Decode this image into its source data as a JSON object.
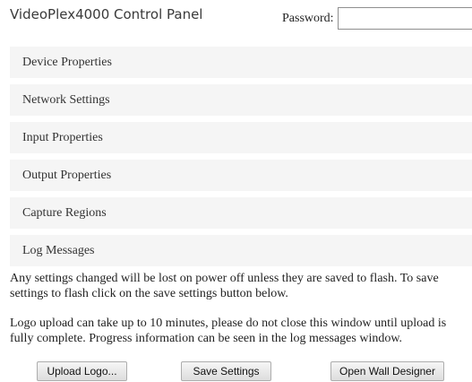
{
  "header": {
    "title": "VideoPlex4000 Control Panel",
    "password_label": "Password:",
    "password_value": ""
  },
  "sections": [
    {
      "label": "Device Properties"
    },
    {
      "label": "Network Settings"
    },
    {
      "label": "Input Properties"
    },
    {
      "label": "Output Properties"
    },
    {
      "label": "Capture Regions"
    },
    {
      "label": "Log Messages"
    }
  ],
  "notices": {
    "save_notice": "Any settings changed will be lost on power off unless they are saved to flash. To save settings to flash click on the save settings button below.",
    "logo_notice": "Logo upload can take up to 10 minutes, please do not close this window until upload is fully complete. Progress information can be seen in the log messages window."
  },
  "buttons": {
    "upload_logo": "Upload Logo...",
    "save_settings": "Save Settings",
    "open_wall_designer": "Open Wall Designer"
  }
}
